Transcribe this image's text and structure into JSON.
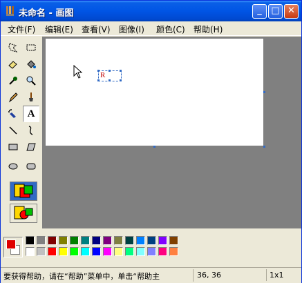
{
  "window": {
    "title": "未命名 - 画图",
    "controls": {
      "minimize": "_",
      "maximize": "□",
      "close": "✕"
    }
  },
  "menu": [
    {
      "label": "文件(F)"
    },
    {
      "label": "编辑(E)"
    },
    {
      "label": "查看(V)"
    },
    {
      "label": "图像(I)"
    },
    {
      "label": "颜色(C)"
    },
    {
      "label": "帮助(H)"
    }
  ],
  "tools": {
    "text_tool_glyph": "A",
    "active": "text-tool"
  },
  "canvas": {
    "text_char": "R"
  },
  "palette": {
    "foreground": "#E00000",
    "background": "#FFFFFF",
    "top_row": [
      "#000000",
      "#808080",
      "#800000",
      "#808000",
      "#008000",
      "#008080",
      "#000080",
      "#800080",
      "#808040",
      "#004040",
      "#0080FF",
      "#004080",
      "#8000FF",
      "#804000"
    ],
    "bottom_row": [
      "#FFFFFF",
      "#C0C0C0",
      "#FF0000",
      "#FFFF00",
      "#00FF00",
      "#00FFFF",
      "#0000FF",
      "#FF00FF",
      "#FFFF80",
      "#00FF80",
      "#80FFFF",
      "#8080FF",
      "#FF0080",
      "#FF8040"
    ]
  },
  "status": {
    "help_text": "要获得帮助，请在“帮助”菜单中，单击“帮助主",
    "coords": "36, 36",
    "size": "1x1"
  }
}
